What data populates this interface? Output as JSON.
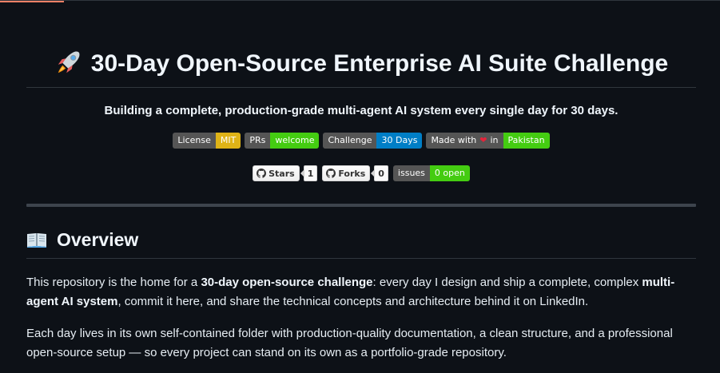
{
  "readme": {
    "title": "30-Day Open-Source Enterprise AI Suite Challenge",
    "title_icon": "rocket-icon",
    "subtitle": "Building a complete, production-grade multi-agent AI system every single day for 30 days.",
    "badges": [
      {
        "label": "License",
        "value": "MIT",
        "color": "#dfb317"
      },
      {
        "label": "PRs",
        "value": "welcome",
        "color": "#4c1"
      },
      {
        "label": "Challenge",
        "value": "30 Days",
        "color": "#007ec6"
      },
      {
        "label_pre": "Made with",
        "label_icon": "heart-icon",
        "label_post": "in",
        "value": "Pakistan",
        "color": "#4c1"
      }
    ],
    "social": {
      "stars_label": "Stars",
      "stars_count": "1",
      "forks_label": "Forks",
      "forks_count": "0",
      "issues_label": "issues",
      "issues_value": "0 open",
      "issues_color": "#4c1"
    },
    "overview": {
      "heading": "Overview",
      "heading_icon": "open-book-icon",
      "p1_a": "This repository is the home for a ",
      "p1_b": "30-day open-source challenge",
      "p1_c": ": every day I design and ship a complete, complex ",
      "p1_d": "multi-agent AI system",
      "p1_e": ", commit it here, and share the technical concepts and architecture behind it on LinkedIn.",
      "p2": "Each day lives in its own self-contained folder with production-quality documentation, a clean structure, and a professional open-source setup — so every project can stand on its own as a portfolio-grade repository."
    }
  }
}
